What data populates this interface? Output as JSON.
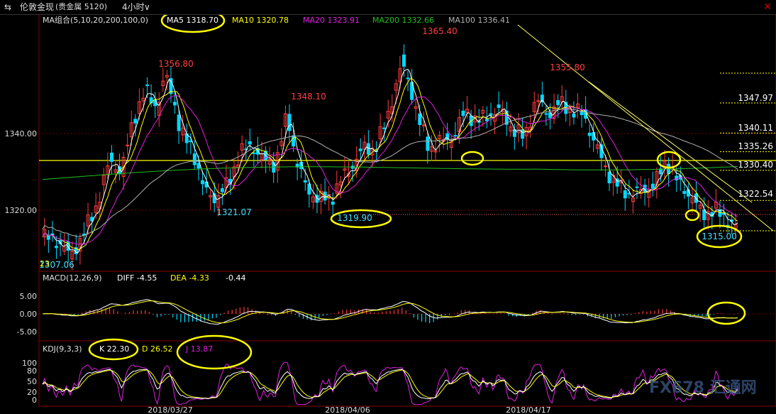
{
  "window": {
    "nav_arrows": "⇆",
    "instrument": "伦敦金现",
    "sub_title": "(贵金属 5120)",
    "period": "4小时",
    "period_arrow": "∨"
  },
  "colors": {
    "up": "#ff3b3b",
    "down": "#00d8ff",
    "ma5": "#ffffff",
    "ma10": "#ffff00",
    "ma20": "#e020e0",
    "ma200": "#20c020",
    "ma100": "#b0b0b0",
    "hline": "#ffff00",
    "trend": "#ffff66",
    "grid": "#7a0000"
  },
  "ma_legend": {
    "group_label": "MA组合(5,10,20,200,100,0)",
    "ma5": "MA5 1318.70",
    "ma10": "MA10 1320.78",
    "ma20": "MA20 1323.91",
    "ma200": "MA200 1332.66",
    "ma100": "MA100 1336.41"
  },
  "macd_legend": {
    "label": "MACD(12,26,9)",
    "diff": "DIFF -4.55",
    "dea": "DEA -4.33",
    "macd": "-0.44"
  },
  "kdj_legend": {
    "label": "KDJ(9,3,3)",
    "k": "K 22.30",
    "d": "D 26.52",
    "j": "J 13.87"
  },
  "price_labels": {
    "high1": "1356.80",
    "high2": "1348.10",
    "high3": "1365.40",
    "high4": "1355.80",
    "low1": "1321.07",
    "low2": "1319.90",
    "low3": "1315.00",
    "low0": "1307.06"
  },
  "corner_label": "23",
  "level_labels": [
    "1347.97",
    "1340.11",
    "1335.26",
    "1330.40",
    "1322.54"
  ],
  "y_axis_price": [
    "1340.00",
    "1320.00"
  ],
  "y_axis_macd": [
    "5.00",
    "0.00",
    "-5.00"
  ],
  "y_axis_kdj": [
    "100",
    "80",
    "50",
    "20",
    "0"
  ],
  "dates": [
    "2018/03/27",
    "2018/04/06",
    "2018/04/17"
  ],
  "watermark": "FX678 汇通网",
  "chart_data": {
    "type": "candlestick",
    "panels": [
      "price",
      "macd",
      "kdj"
    ],
    "price_ylim": [
      1303,
      1372
    ],
    "price_high_points": [
      {
        "date_index": "2018/03/27 area",
        "value": 1356.8
      },
      {
        "date_index": "early April",
        "value": 1348.1
      },
      {
        "date_index": "mid April",
        "value": 1365.4
      },
      {
        "date_index": "after 2018/04/17",
        "value": 1355.8
      }
    ],
    "price_low_points": [
      {
        "value": 1307.06
      },
      {
        "value": 1321.07
      },
      {
        "value": 1319.9
      },
      {
        "value": 1315.0
      }
    ],
    "horizontal_levels": [
      1347.97,
      1340.11,
      1335.26,
      1330.4,
      1322.54
    ],
    "moving_averages": {
      "MA5": 1318.7,
      "MA10": 1320.78,
      "MA20": 1323.91,
      "MA200": 1332.66,
      "MA100": 1336.41
    },
    "macd": {
      "DIFF": -4.55,
      "DEA": -4.33,
      "MACD": -0.44,
      "ylim": [
        -7,
        9
      ]
    },
    "kdj": {
      "K": 22.3,
      "D": 26.52,
      "J": 13.87,
      "ylim": [
        -10,
        120
      ]
    },
    "x_dates": [
      "2018/03/27",
      "2018/04/06",
      "2018/04/17"
    ]
  }
}
